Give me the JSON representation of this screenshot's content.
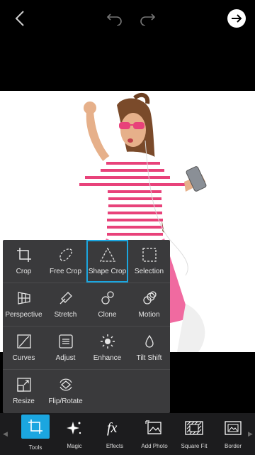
{
  "tools_panel": {
    "rows": [
      [
        {
          "label": "Crop",
          "icon": "crop-icon"
        },
        {
          "label": "Free Crop",
          "icon": "free-crop-icon"
        },
        {
          "label": "Shape Crop",
          "icon": "shape-crop-icon",
          "selected": true
        },
        {
          "label": "Selection",
          "icon": "selection-icon"
        }
      ],
      [
        {
          "label": "Perspective",
          "icon": "perspective-icon"
        },
        {
          "label": "Stretch",
          "icon": "stretch-icon"
        },
        {
          "label": "Clone",
          "icon": "clone-icon"
        },
        {
          "label": "Motion",
          "icon": "motion-icon"
        }
      ],
      [
        {
          "label": "Curves",
          "icon": "curves-icon"
        },
        {
          "label": "Adjust",
          "icon": "adjust-icon"
        },
        {
          "label": "Enhance",
          "icon": "enhance-icon"
        },
        {
          "label": "Tilt Shift",
          "icon": "tilt-shift-icon"
        }
      ],
      [
        {
          "label": "Resize",
          "icon": "resize-icon"
        },
        {
          "label": "Flip/Rotate",
          "icon": "flip-rotate-icon"
        }
      ]
    ]
  },
  "bottom_bar": {
    "items": [
      {
        "label": "Tools",
        "icon": "crop-icon",
        "active": true
      },
      {
        "label": "Magic",
        "icon": "magic-icon"
      },
      {
        "label": "Effects",
        "icon": "fx-icon"
      },
      {
        "label": "Add Photo",
        "icon": "add-photo-icon"
      },
      {
        "label": "Square Fit",
        "icon": "square-fit-icon"
      },
      {
        "label": "Border",
        "icon": "border-icon"
      }
    ]
  },
  "colors": {
    "accent": "#1ba6e0",
    "panel": "#3a3a3c",
    "bar": "#1c1c1e",
    "shirt_stripe": "#e8427a",
    "skirt": "#f06aa0"
  }
}
